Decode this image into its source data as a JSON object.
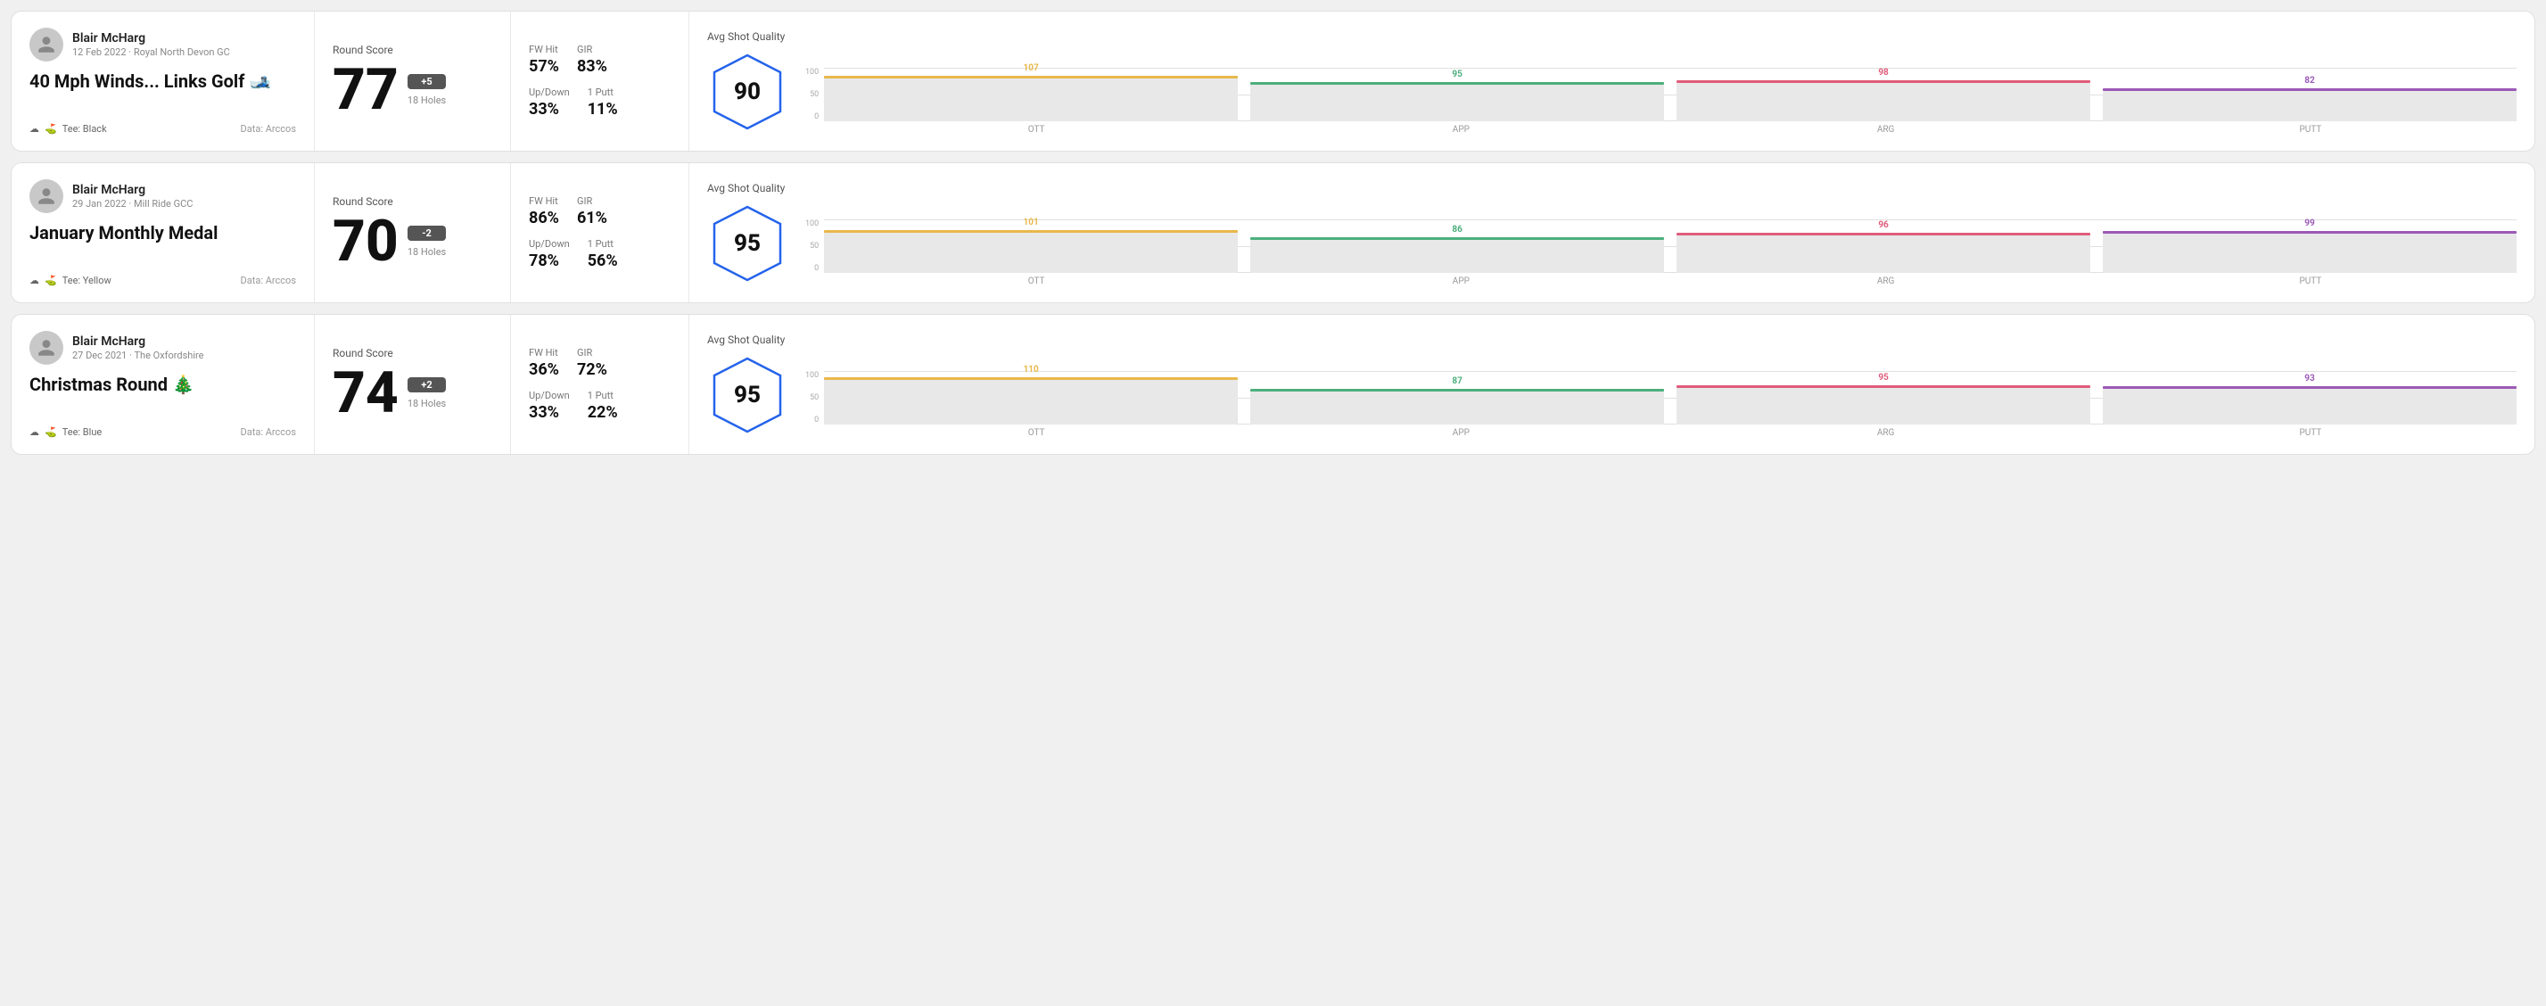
{
  "rounds": [
    {
      "id": "round1",
      "user_name": "Blair McHarg",
      "user_date": "12 Feb 2022 · Royal North Devon GC",
      "round_title": "40 Mph Winds... Links Golf 🎿",
      "tee": "Black",
      "data_source": "Data: Arccos",
      "score": "77",
      "score_diff": "+5",
      "score_holes": "18 Holes",
      "fw_hit": "57%",
      "gir": "83%",
      "up_down": "33%",
      "one_putt": "11%",
      "avg_quality": "90",
      "chart": {
        "bars": [
          {
            "label": "OTT",
            "value": 107,
            "color": "#e8b84b",
            "pct": 85
          },
          {
            "label": "APP",
            "value": 95,
            "color": "#4caf7d",
            "pct": 73
          },
          {
            "label": "ARG",
            "value": 98,
            "color": "#e05c7a",
            "pct": 76
          },
          {
            "label": "PUTT",
            "value": 82,
            "color": "#9b59b6",
            "pct": 62
          }
        ]
      }
    },
    {
      "id": "round2",
      "user_name": "Blair McHarg",
      "user_date": "29 Jan 2022 · Mill Ride GCC",
      "round_title": "January Monthly Medal",
      "tee": "Yellow",
      "data_source": "Data: Arccos",
      "score": "70",
      "score_diff": "-2",
      "score_holes": "18 Holes",
      "fw_hit": "86%",
      "gir": "61%",
      "up_down": "78%",
      "one_putt": "56%",
      "avg_quality": "95",
      "chart": {
        "bars": [
          {
            "label": "OTT",
            "value": 101,
            "color": "#e8b84b",
            "pct": 80
          },
          {
            "label": "APP",
            "value": 86,
            "color": "#4caf7d",
            "pct": 66
          },
          {
            "label": "ARG",
            "value": 96,
            "color": "#e05c7a",
            "pct": 75
          },
          {
            "label": "PUTT",
            "value": 99,
            "color": "#9b59b6",
            "pct": 78
          }
        ]
      }
    },
    {
      "id": "round3",
      "user_name": "Blair McHarg",
      "user_date": "27 Dec 2021 · The Oxfordshire",
      "round_title": "Christmas Round 🎄",
      "tee": "Blue",
      "data_source": "Data: Arccos",
      "score": "74",
      "score_diff": "+2",
      "score_holes": "18 Holes",
      "fw_hit": "36%",
      "gir": "72%",
      "up_down": "33%",
      "one_putt": "22%",
      "avg_quality": "95",
      "chart": {
        "bars": [
          {
            "label": "OTT",
            "value": 110,
            "color": "#e8b84b",
            "pct": 88
          },
          {
            "label": "APP",
            "value": 87,
            "color": "#4caf7d",
            "pct": 67
          },
          {
            "label": "ARG",
            "value": 95,
            "color": "#e05c7a",
            "pct": 74
          },
          {
            "label": "PUTT",
            "value": 93,
            "color": "#9b59b6",
            "pct": 72
          }
        ]
      }
    }
  ],
  "labels": {
    "round_score": "Round Score",
    "fw_hit": "FW Hit",
    "gir": "GIR",
    "up_down": "Up/Down",
    "one_putt": "1 Putt",
    "avg_quality": "Avg Shot Quality",
    "tee_prefix": "Tee:",
    "axis_100": "100",
    "axis_50": "50",
    "axis_0": "0"
  }
}
